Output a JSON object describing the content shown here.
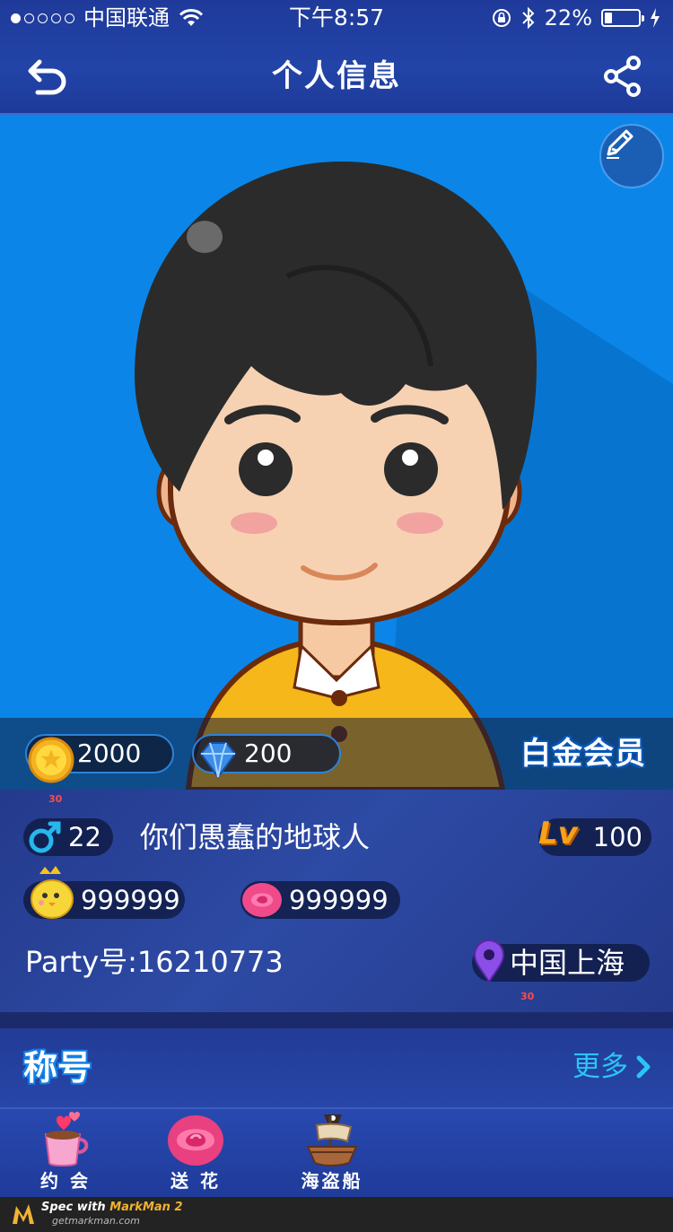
{
  "status_bar": {
    "carrier": "中国联通",
    "time": "下午8:57",
    "battery_percent": "22%",
    "battery_level": 0.22,
    "signal_bars_filled": 1,
    "signal_bars_total": 5
  },
  "header": {
    "title": "个人信息",
    "back_icon": "back-arrow-icon",
    "share_icon": "share-icon"
  },
  "hero": {
    "edit_icon": "pencil-icon",
    "background_color": "#0b86e8"
  },
  "wallet": {
    "coins": "2000",
    "diamonds": "200",
    "membership": "白金会员"
  },
  "profile": {
    "age": "22",
    "nickname": "你们愚蠢的地球人",
    "level_badge": "Lv",
    "level": "100",
    "pet_count": "999999",
    "rose_count": "999999",
    "party_id": "Party号:16210773",
    "location": "中国上海"
  },
  "spec_marks": {
    "top": "30",
    "bottom": "30"
  },
  "titles_section": {
    "label": "称号",
    "more": "更多"
  },
  "actions": [
    {
      "label": "约 会",
      "icon": "coffee-heart-icon"
    },
    {
      "label": "送 花",
      "icon": "rose-icon"
    },
    {
      "label": "海盗船",
      "icon": "pirate-ship-icon"
    }
  ],
  "footer": {
    "spec_with": "Spec with ",
    "brand": "MarkMan 2",
    "site": "getmarkman.com"
  },
  "colors": {
    "accent": "#2bc4f6",
    "header_blue": "#2244a8",
    "panel_blue": "#2d4aa4",
    "hero_blue": "#0b86e8"
  }
}
